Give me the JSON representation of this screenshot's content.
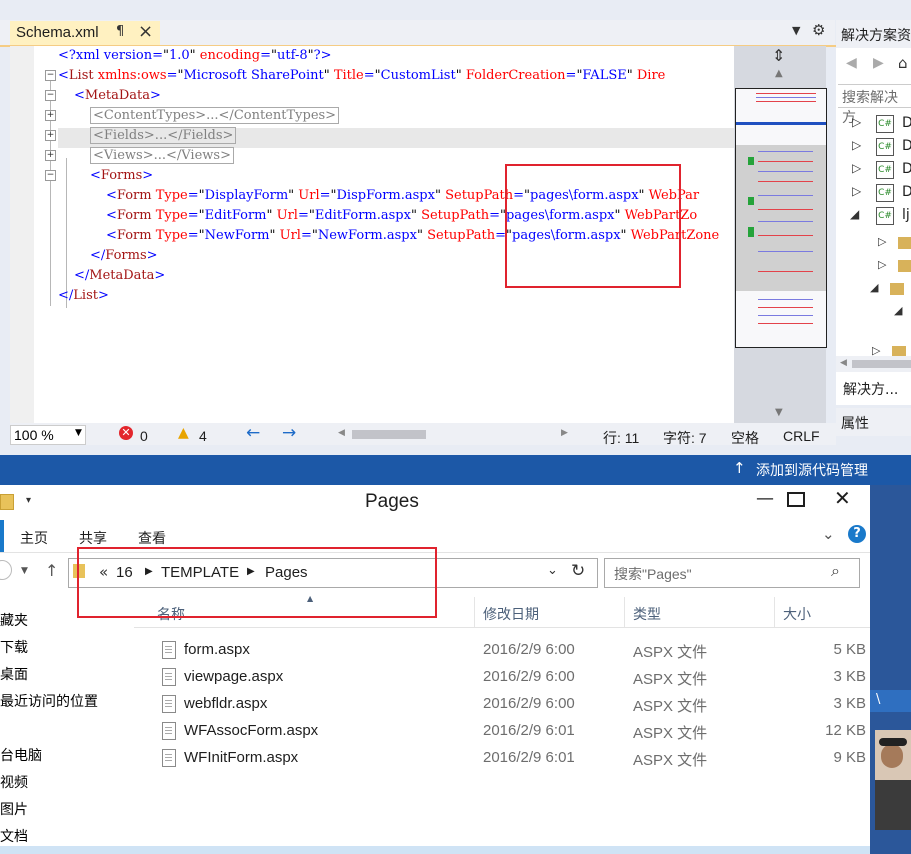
{
  "vs": {
    "tab_title": "Schema.xml",
    "tab_pin": "¶",
    "tab_close": "×",
    "code_lines": [
      [
        [
          "b",
          "<?xml version="
        ],
        [
          "k",
          "\""
        ],
        [
          "b",
          "1.0"
        ],
        [
          "k",
          "\" "
        ],
        [
          "r",
          "encoding"
        ],
        [
          "b",
          "="
        ],
        [
          "k",
          "\""
        ],
        [
          "b",
          "utf-8"
        ],
        [
          "k",
          "\""
        ],
        [
          "b",
          "?>"
        ]
      ],
      [
        [
          "b",
          "<"
        ],
        [
          "m",
          "List "
        ],
        [
          "r",
          "xmlns:ows"
        ],
        [
          "b",
          "="
        ],
        [
          "k",
          "\""
        ],
        [
          "b",
          "Microsoft SharePoint"
        ],
        [
          "k",
          "\" "
        ],
        [
          "r",
          "Title"
        ],
        [
          "b",
          "="
        ],
        [
          "k",
          "\""
        ],
        [
          "b",
          "CustomList"
        ],
        [
          "k",
          "\" "
        ],
        [
          "r",
          "FolderCreation"
        ],
        [
          "b",
          "="
        ],
        [
          "k",
          "\""
        ],
        [
          "b",
          "FALSE"
        ],
        [
          "k",
          "\" "
        ],
        [
          "r",
          "Dire"
        ]
      ],
      [
        [
          "b",
          "<"
        ],
        [
          "m",
          "MetaData"
        ],
        [
          "b",
          ">"
        ]
      ],
      [
        [
          "box",
          "<ContentTypes>...</ContentTypes>"
        ]
      ],
      [
        [
          "box",
          "<Fields>...</Fields>"
        ]
      ],
      [
        [
          "box",
          "<Views>...</Views>"
        ]
      ],
      [
        [
          "b",
          "<"
        ],
        [
          "m",
          "Forms"
        ],
        [
          "b",
          ">"
        ]
      ],
      [
        [
          "b",
          "<"
        ],
        [
          "m",
          "Form "
        ],
        [
          "r",
          "Type"
        ],
        [
          "b",
          "="
        ],
        [
          "k",
          "\""
        ],
        [
          "b",
          "DisplayForm"
        ],
        [
          "k",
          "\" "
        ],
        [
          "r",
          "Url"
        ],
        [
          "b",
          "="
        ],
        [
          "k",
          "\""
        ],
        [
          "b",
          "DispForm.aspx"
        ],
        [
          "k",
          "\" "
        ],
        [
          "r",
          "SetupPath"
        ],
        [
          "b",
          "="
        ],
        [
          "k",
          "\""
        ],
        [
          "b",
          "pages\\form.aspx"
        ],
        [
          "k",
          "\" "
        ],
        [
          "r",
          "WebPar"
        ]
      ],
      [
        [
          "b",
          "<"
        ],
        [
          "m",
          "Form "
        ],
        [
          "r",
          "Type"
        ],
        [
          "b",
          "="
        ],
        [
          "k",
          "\""
        ],
        [
          "b",
          "EditForm"
        ],
        [
          "k",
          "\" "
        ],
        [
          "r",
          "Url"
        ],
        [
          "b",
          "="
        ],
        [
          "k",
          "\""
        ],
        [
          "b",
          "EditForm.aspx"
        ],
        [
          "k",
          "\" "
        ],
        [
          "r",
          "SetupPath"
        ],
        [
          "b",
          "="
        ],
        [
          "k",
          "\""
        ],
        [
          "b",
          "pages\\form.aspx"
        ],
        [
          "k",
          "\" "
        ],
        [
          "r",
          "WebPartZo"
        ]
      ],
      [
        [
          "b",
          "<"
        ],
        [
          "m",
          "Form "
        ],
        [
          "r",
          "Type"
        ],
        [
          "b",
          "="
        ],
        [
          "k",
          "\""
        ],
        [
          "b",
          "NewForm"
        ],
        [
          "k",
          "\" "
        ],
        [
          "r",
          "Url"
        ],
        [
          "b",
          "="
        ],
        [
          "k",
          "\""
        ],
        [
          "b",
          "NewForm.aspx"
        ],
        [
          "k",
          "\" "
        ],
        [
          "r",
          "SetupPath"
        ],
        [
          "b",
          "="
        ],
        [
          "k",
          "\""
        ],
        [
          "b",
          "pages\\form.aspx"
        ],
        [
          "k",
          "\" "
        ],
        [
          "r",
          "WebPartZone"
        ]
      ],
      [
        [
          "b",
          "</"
        ],
        [
          "m",
          "Forms"
        ],
        [
          "b",
          ">"
        ]
      ],
      [
        [
          "b",
          "</"
        ],
        [
          "m",
          "MetaData"
        ],
        [
          "b",
          ">"
        ]
      ],
      [
        [
          "b",
          "</"
        ],
        [
          "m",
          "List"
        ],
        [
          "b",
          ">"
        ]
      ]
    ],
    "zoom": "100 %",
    "errors": "0",
    "warnings": "4",
    "status_row": "行: 11",
    "status_col": "字符: 7",
    "status_space": "空格",
    "status_eol": "CRLF",
    "solution_title": "解决方案资",
    "solution_search": "搜索解决方",
    "solution_items": [
      "D",
      "D",
      "D",
      "D",
      "lj"
    ],
    "solution_tab": "解决方...",
    "properties_title": "属性",
    "source_control": "添加到源代码管理"
  },
  "explorer": {
    "title": "Pages",
    "ribbon_tabs": [
      "主页",
      "共享",
      "查看"
    ],
    "breadcrumb_prefix": "«",
    "breadcrumb": [
      "16",
      "TEMPLATE",
      "Pages"
    ],
    "search_placeholder": "搜索\"Pages\"",
    "columns": {
      "name": "名称",
      "date": "修改日期",
      "type": "类型",
      "size": "大小"
    },
    "nav_items": [
      "藏夹",
      "下载",
      "桌面",
      "最近访问的位置",
      "台电脑",
      "视频",
      "图片",
      "文档"
    ],
    "files": [
      {
        "name": "form.aspx",
        "date": "2016/2/9 6:00",
        "type": "ASPX 文件",
        "size": "5 KB"
      },
      {
        "name": "viewpage.aspx",
        "date": "2016/2/9 6:00",
        "type": "ASPX 文件",
        "size": "3 KB"
      },
      {
        "name": "webfldr.aspx",
        "date": "2016/2/9 6:00",
        "type": "ASPX 文件",
        "size": "3 KB"
      },
      {
        "name": "WFAssocForm.aspx",
        "date": "2016/2/9 6:01",
        "type": "ASPX 文件",
        "size": "12 KB"
      },
      {
        "name": "WFInitForm.aspx",
        "date": "2016/2/9 6:01",
        "type": "ASPX 文件",
        "size": "9 KB"
      }
    ],
    "side_fragment": "\\"
  },
  "colors": {
    "vs_status": "#1c58a7",
    "highlight": "#e0232e",
    "tab_active": "#fff1c1"
  }
}
